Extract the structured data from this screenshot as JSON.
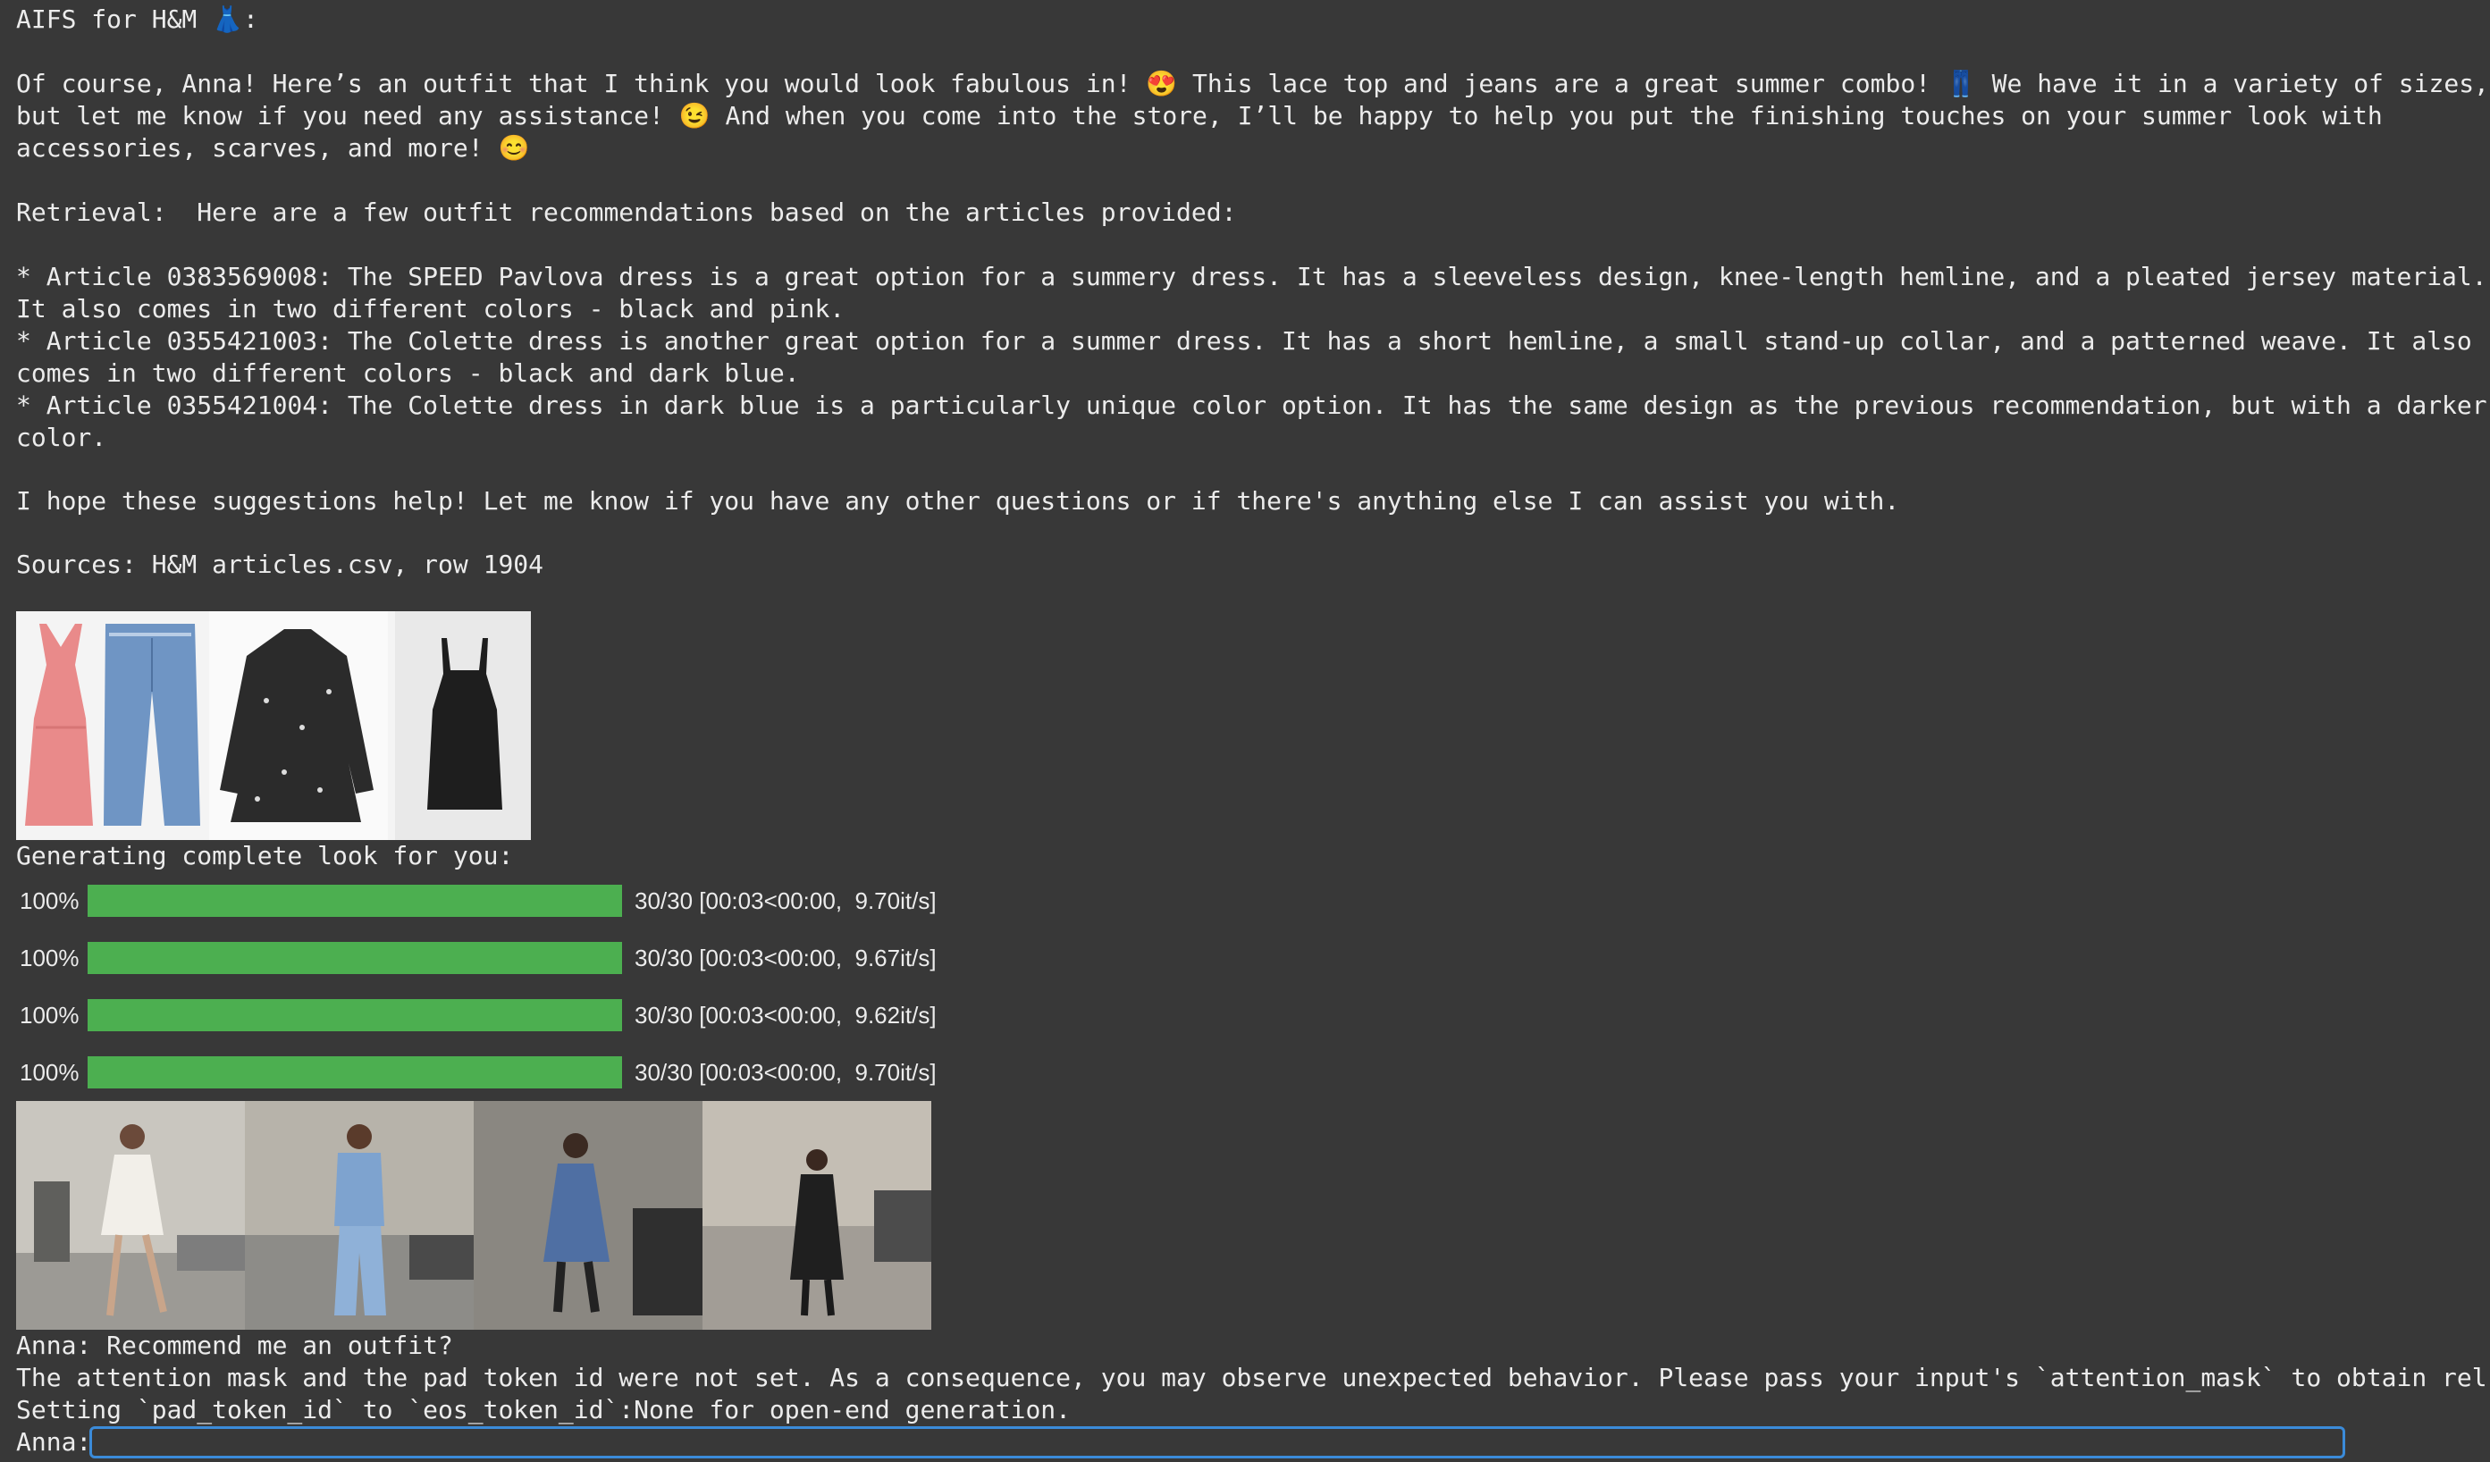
{
  "assistant_header": "AIFS for H&M 👗:",
  "assistant_reply": [
    "Of course, Anna! Here’s an outfit that I think you would look fabulous in! 😍 This lace top and jeans are a great summer combo! 👖 We have it in a variety of sizes,",
    "but let me know if you need any assistance! 😉 And when you come into the store, I’ll be happy to help you put the finishing touches on your summer look with",
    "accessories, scarves, and more! 😊"
  ],
  "retrieval_intro": "Retrieval:  Here are a few outfit recommendations based on the articles provided:",
  "retrieval_items": [
    "* Article 0383569008: The SPEED Pavlova dress is a great option for a summery dress. It has a sleeveless design, knee-length hemline, and a pleated jersey material.",
    "It also comes in two different colors - black and pink.",
    "* Article 0355421003: The Colette dress is another great option for a summer dress. It has a short hemline, a small stand-up collar, and a patterned weave. It also",
    "comes in two different colors - black and dark blue.",
    "* Article 0355421004: The Colette dress in dark blue is a particularly unique color option. It has the same design as the previous recommendation, but with a darker",
    "color."
  ],
  "closing": "I hope these suggestions help! Let me know if you have any other questions or if there's anything else I can assist you with.",
  "sources": "Sources: H&M articles.csv, row 1904",
  "article_images": [
    "pink-dress-icon",
    "jeans-icon",
    "black-floral-dress-icon",
    "black-slip-dress-icon"
  ],
  "generating_label": "Generating complete look for you:",
  "progress": [
    {
      "pct": "100%",
      "fraction": 1.0,
      "stats": "30/30 [00:03<00:00,  9.70it/s]"
    },
    {
      "pct": "100%",
      "fraction": 1.0,
      "stats": "30/30 [00:03<00:00,  9.67it/s]"
    },
    {
      "pct": "100%",
      "fraction": 1.0,
      "stats": "30/30 [00:03<00:00,  9.62it/s]"
    },
    {
      "pct": "100%",
      "fraction": 1.0,
      "stats": "30/30 [00:03<00:00,  9.70it/s]"
    }
  ],
  "generated_images": [
    "model-white-dress-photo",
    "model-denim-outfit-photo",
    "model-blue-dress-photo",
    "model-black-dress-photo"
  ],
  "user_prompt": "Anna: Recommend me an outfit?",
  "warning_line": "The attention mask and the pad token id were not set. As a consequence, you may observe unexpected behavior. Please pass your input's `attention_mask` to obtain rel",
  "setting_line": "Setting `pad_token_id` to `eos_token_id`:None for open-end generation.",
  "input_prompt": "Anna:",
  "input_value": "",
  "colors": {
    "background": "#383838",
    "text": "#ececec",
    "progress": "#4caf50",
    "input_border": "#3b8bd9"
  }
}
